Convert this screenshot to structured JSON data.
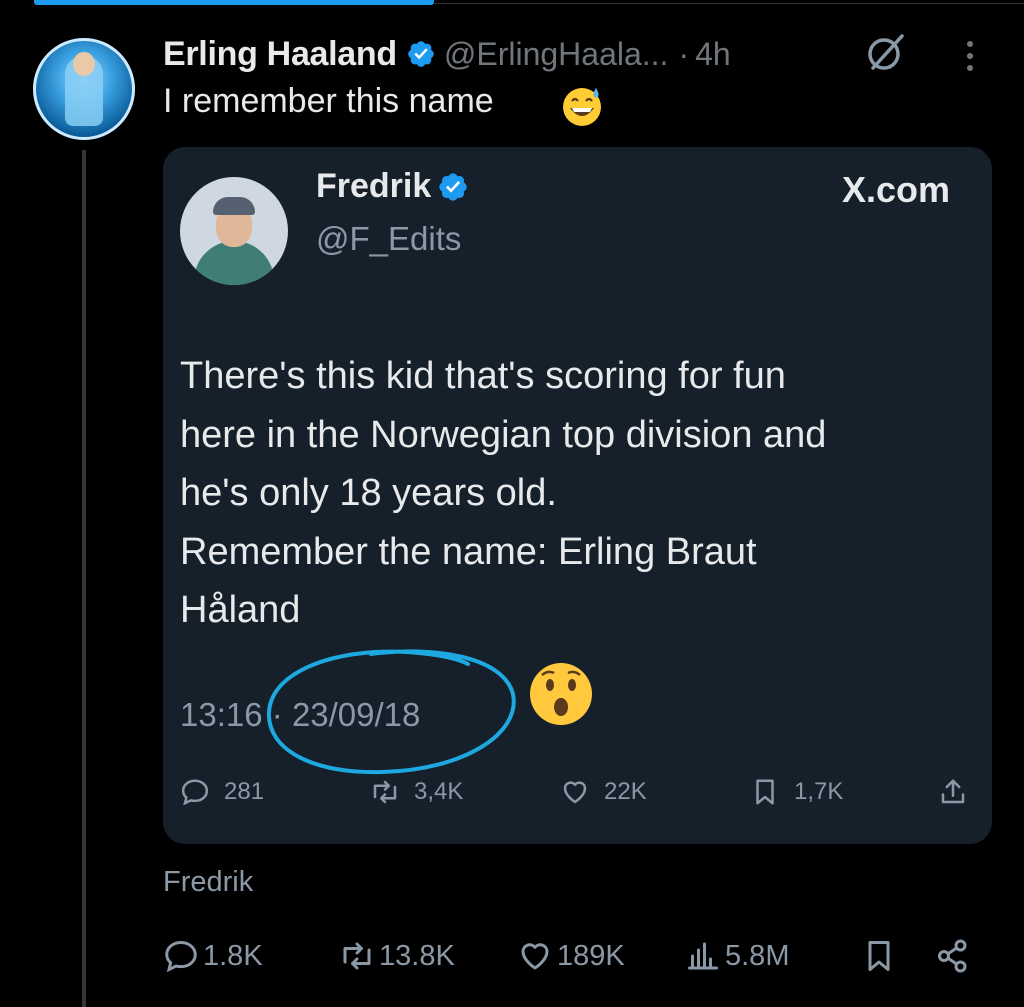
{
  "post": {
    "author_name": "Erling Haaland",
    "handle": "@ErlingHaala...",
    "separator": "·",
    "time_ago": "4h",
    "text": "I remember this name",
    "emoji": "grinning-sweat",
    "icons": {
      "grok": "grok-icon",
      "more": "more-vertical-icon",
      "verified": "verified-badge-icon"
    }
  },
  "quoted": {
    "name": "Fredrik",
    "handle": "@F_Edits",
    "site": "X.com",
    "text_lines": [
      "There's this kid that's scoring for fun",
      "here in the Norwegian top division and",
      "he's only 18 years old.",
      "Remember the name: Erling Braut",
      "Håland"
    ],
    "time": "13:16",
    "separator": "·",
    "date": "23/09/18",
    "emoji": "astonished",
    "stats": {
      "replies": "281",
      "reposts": "3,4K",
      "likes": "22K",
      "bookmarks": "1,7K"
    }
  },
  "source_label": "Fredrik",
  "metrics": {
    "replies": "1.8K",
    "reposts": "13.8K",
    "likes": "189K",
    "views": "5.8M"
  },
  "colors": {
    "background": "#000000",
    "card": "#15202b",
    "verified": "#1d9bf0",
    "annotation_circle": "#1da9e0",
    "muted": "#8b98a5"
  }
}
